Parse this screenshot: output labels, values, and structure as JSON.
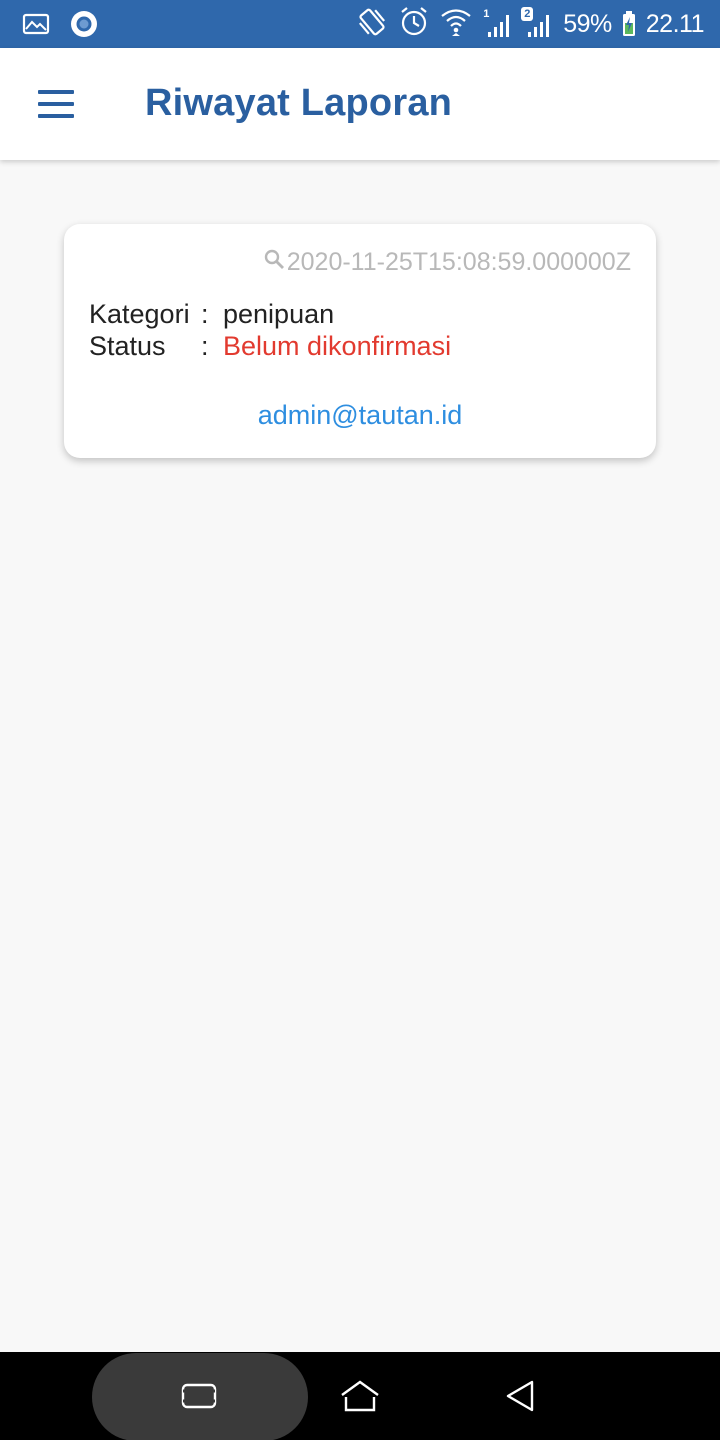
{
  "status_bar": {
    "battery": "59%",
    "time": "22.11",
    "sim1_label": "1",
    "sim2_label": "2",
    "icons": [
      "gallery-icon",
      "record-icon",
      "vibrate-icon",
      "alarm-icon",
      "wifi-icon",
      "signal-icon",
      "signal-icon",
      "battery-icon"
    ]
  },
  "app_bar": {
    "title": "Riwayat Laporan",
    "menu_icon": "hamburger-menu-icon"
  },
  "report": {
    "timestamp": "2020-11-25T15:08:59.000000Z",
    "category_label": "Kategori",
    "category_value": "penipuan",
    "status_label": "Status",
    "separator": ":",
    "status_value": "Belum dikonfirmasi",
    "email": "admin@tautan.id"
  },
  "colors": {
    "status_bar": "#2f68ac",
    "primary": "#2a5fa0",
    "status_unconfirmed": "#e23a2f",
    "link": "#2e8ee0",
    "timestamp": "#b8b8b8"
  },
  "nav_bar": {
    "icons": [
      "recents-icon",
      "home-icon",
      "back-icon"
    ]
  }
}
